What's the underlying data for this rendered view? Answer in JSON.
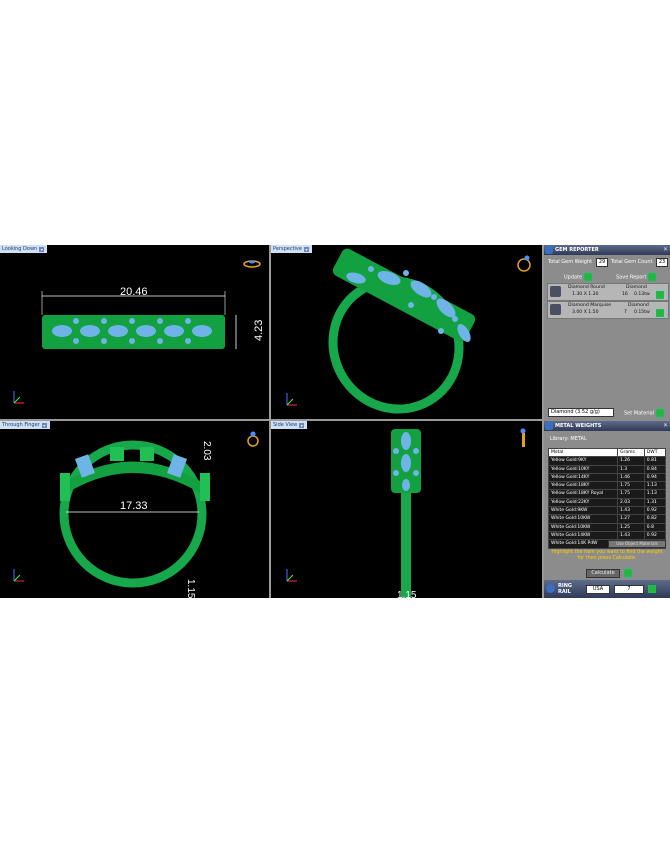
{
  "viewports": {
    "top_left": {
      "label": "Looking Down",
      "dim_width": "20.46",
      "dim_height": "4.23"
    },
    "top_right": {
      "label": "Perspective"
    },
    "bottom_left": {
      "label": "Through Finger",
      "dim_inner": "17.33",
      "dim_top": "2.03",
      "dim_bottom": "1.15"
    },
    "bottom_right": {
      "label": "Side View",
      "dim_bottom": "1.15"
    }
  },
  "gem_reporter": {
    "title": "GEM REPORTER",
    "total_weight_label": "Total Gem Weight",
    "total_weight_value": "29",
    "total_count_label": "Total Gem Count",
    "total_count_value": "23",
    "update_label": "Update",
    "save_label": "Save Report",
    "gems": [
      {
        "name": "Diamond Round",
        "size": "1.30 X 1.30",
        "type": "Diamond",
        "count": "16",
        "weight": "0.13tw"
      },
      {
        "name": "Diamond Marquise",
        "size": "3.00 X 1.50",
        "type": "Diamond",
        "count": "7",
        "weight": "0.15tw"
      }
    ],
    "material_select": "Diamond   (3.52 g/g)",
    "set_material_label": "Set Material"
  },
  "metal_weights": {
    "title": "METAL WEIGHTS",
    "library_label": "Library: METAL",
    "columns": [
      "Metal",
      "Grams",
      "DWT"
    ],
    "rows": [
      [
        "Yellow Gold:9KY",
        "1.26",
        "0.81"
      ],
      [
        "Yellow Gold:10KY",
        "1.3",
        "0.84"
      ],
      [
        "Yellow Gold:14KY",
        "1.46",
        "0.94"
      ],
      [
        "Yellow Gold:18KY",
        "1.75",
        "1.13"
      ],
      [
        "Yellow Gold:18KY Royal",
        "1.75",
        "1.13"
      ],
      [
        "Yellow Gold:22KY",
        "2.03",
        "1.31"
      ],
      [
        "White Gold:9KW",
        "1.43",
        "0.92"
      ],
      [
        "White Gold:10KW",
        "1.27",
        "0.82"
      ],
      [
        "White Gold:10KW",
        "1.25",
        "0.8"
      ],
      [
        "White Gold:14KW",
        "1.43",
        "0.92"
      ],
      [
        "White Gold:14K PdW",
        "1.63",
        "1.05"
      ]
    ],
    "use_objects_label": "Use Object Materials",
    "hint": "Highlight the item you want to find the weight for then press Calculate.",
    "calculate_label": "Calculate"
  },
  "ring_rail": {
    "label": "RING RAIL",
    "region": "USA",
    "size": "7"
  },
  "colors": {
    "metal": "#1fb84a",
    "gem": "#6fb4e6",
    "background": "#000000",
    "panel": "#8c8c8c"
  }
}
